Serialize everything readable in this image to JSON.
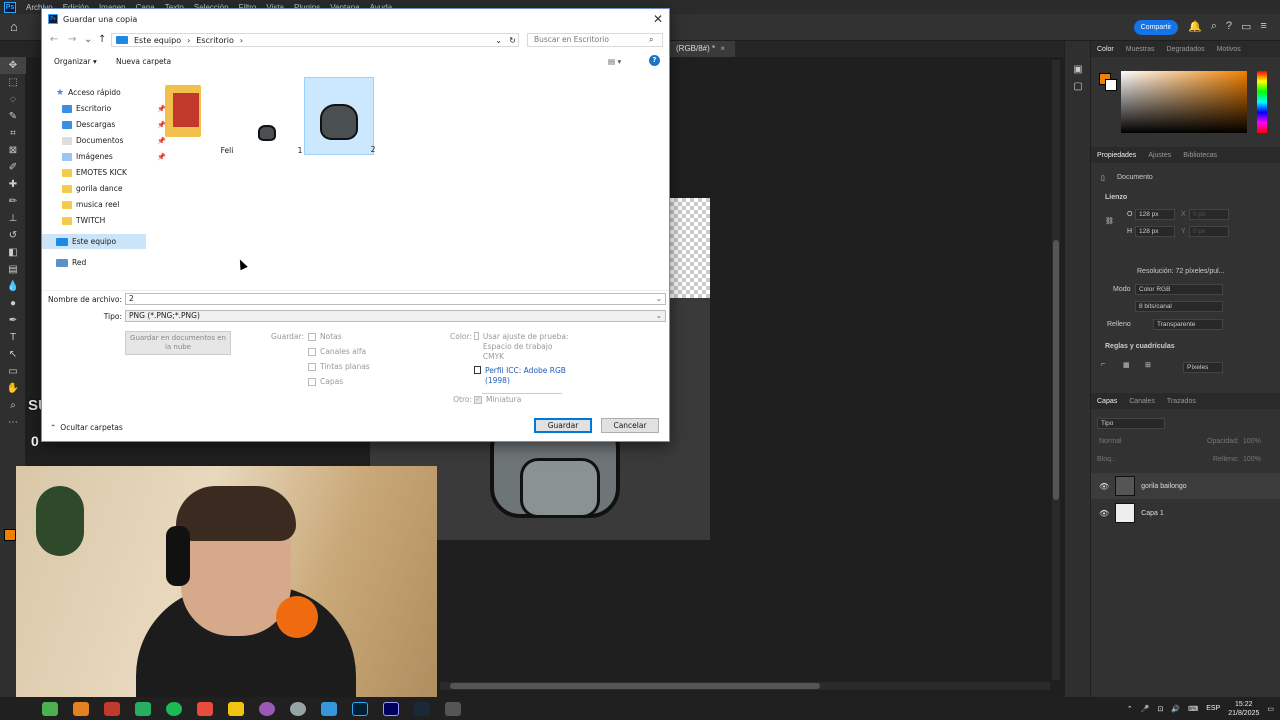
{
  "photoshop": {
    "menu": [
      "Archivo",
      "Edición",
      "Imagen",
      "Capa",
      "Texto",
      "Selección",
      "Filtro",
      "Vista",
      "Plugins",
      "Ventana",
      "Ayuda"
    ],
    "share_label": "Compartir",
    "doc_tab_label": "(RGB/8#) *",
    "color_panel": {
      "tabs": [
        "Color",
        "Muestras",
        "Degradados",
        "Motivos"
      ],
      "fg_color": "#f08000"
    },
    "properties": {
      "tabs": [
        "Propiedades",
        "Ajustes",
        "Bibliotecas"
      ],
      "doc_label": "Documento",
      "section_canvas": "Lienzo",
      "w_label": "O",
      "w_value": "128 px",
      "h_label": "H",
      "h_value": "128 px",
      "x_label": "X",
      "x_value": "0 px",
      "y_label": "Y",
      "y_value": "0 px",
      "resolution": "Resolución: 72 píxeles/pul...",
      "mode_label": "Modo",
      "mode_value": "Color RGB",
      "depth_value": "8 bits/canal",
      "fill_label": "Relleno",
      "fill_value": "Transparente",
      "guides_section": "Reglas y cuadrículas",
      "units_value": "Píxeles"
    },
    "layers": {
      "tabs": [
        "Capas",
        "Canales",
        "Trazados"
      ],
      "filter": "Tipo",
      "blend": "Normal",
      "opacity_label": "Opacidad:",
      "opacity_value": "100%",
      "lock_label": "Bloq.:",
      "fill_label": "Relleno:",
      "fill_value": "100%",
      "items": [
        {
          "name": "gorila bailongo"
        },
        {
          "name": "Capa 1"
        }
      ]
    }
  },
  "overlay": {
    "subs_label": "SUBS",
    "subs_count": "0"
  },
  "dialog": {
    "title": "Guardar una copia",
    "breadcrumb": [
      "Este equipo",
      "Escritorio"
    ],
    "search_placeholder": "Buscar en Escritorio",
    "organize": "Organizar",
    "new_folder": "Nueva carpeta",
    "nav": {
      "quick_access": "Acceso rápido",
      "items": [
        {
          "label": "Escritorio",
          "pinned": true
        },
        {
          "label": "Descargas",
          "pinned": true
        },
        {
          "label": "Documentos",
          "pinned": true
        },
        {
          "label": "Imágenes",
          "pinned": true
        },
        {
          "label": "EMOTES KICK",
          "pinned": false
        },
        {
          "label": "gorila dance",
          "pinned": false
        },
        {
          "label": "musica reel",
          "pinned": false
        },
        {
          "label": "TWITCH",
          "pinned": false
        }
      ],
      "this_pc": "Este equipo",
      "network": "Red"
    },
    "files": [
      {
        "name": "Feli",
        "kind": "folder"
      },
      {
        "name": "1",
        "kind": "image"
      },
      {
        "name": "2",
        "kind": "image",
        "selected": true
      }
    ],
    "filename_label": "Nombre de archivo:",
    "filename_value": "2",
    "type_label": "Tipo:",
    "type_value": "PNG (*.PNG;*.PNG)",
    "cloud_btn": "Guardar en documentos en la nube",
    "save_label": "Guardar:",
    "save_options": [
      "Notas",
      "Canales alfa",
      "Tintas planas",
      "Capas"
    ],
    "color_label": "Color:",
    "proof_label": "Usar ajuste de prueba: Espacio de trabajo CMYK",
    "icc_label": "Perfil ICC: Adobe RGB (1998)",
    "other_label": "Otro:",
    "thumbnail_label": "Miniatura",
    "hide_folders": "Ocultar carpetas",
    "save_button": "Guardar",
    "cancel_button": "Cancelar"
  },
  "taskbar": {
    "lang": "ESP",
    "time": "15:22",
    "date": "21/8/2025"
  }
}
